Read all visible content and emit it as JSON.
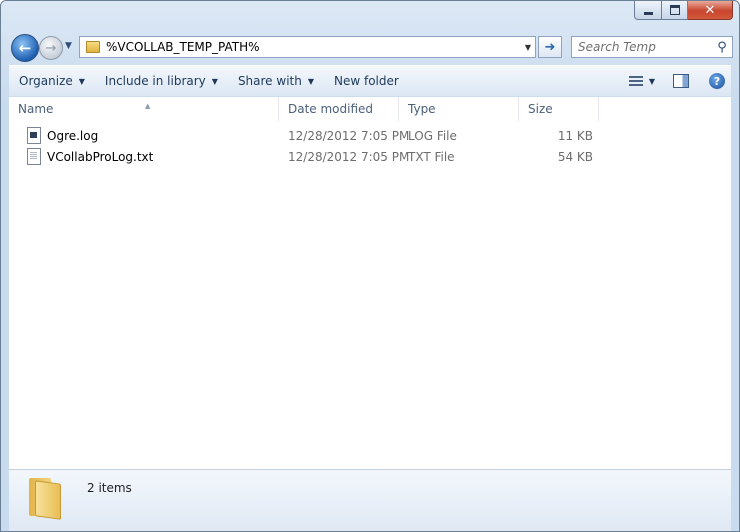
{
  "address": {
    "path": "%VCOLLAB_TEMP_PATH%"
  },
  "search": {
    "placeholder": "Search Temp"
  },
  "toolbar": {
    "organize": "Organize",
    "include_in_library": "Include in library",
    "share_with": "Share with",
    "new_folder": "New folder"
  },
  "columns": {
    "name": "Name",
    "date": "Date modified",
    "type": "Type",
    "size": "Size"
  },
  "files": [
    {
      "name": "Ogre.log",
      "date": "12/28/2012 7:05 PM",
      "type": "LOG File",
      "size": "11 KB",
      "icon": "log-file-icon"
    },
    {
      "name": "VCollabProLog.txt",
      "date": "12/28/2012 7:05 PM",
      "type": "TXT File",
      "size": "54 KB",
      "icon": "text-file-icon"
    }
  ],
  "status": {
    "item_count": "2 items"
  }
}
